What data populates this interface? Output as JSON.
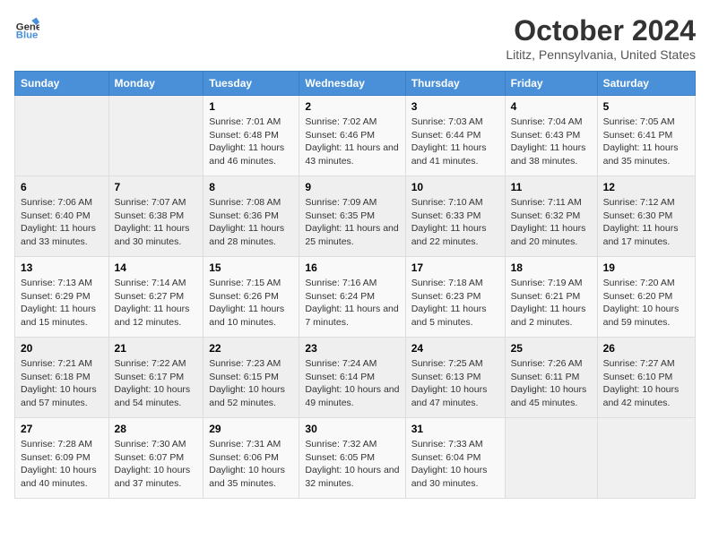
{
  "logo": {
    "general": "General",
    "blue": "Blue"
  },
  "title": "October 2024",
  "subtitle": "Lititz, Pennsylvania, United States",
  "days_of_week": [
    "Sunday",
    "Monday",
    "Tuesday",
    "Wednesday",
    "Thursday",
    "Friday",
    "Saturday"
  ],
  "weeks": [
    [
      {
        "day": "",
        "info": ""
      },
      {
        "day": "",
        "info": ""
      },
      {
        "day": "1",
        "info": "Sunrise: 7:01 AM\nSunset: 6:48 PM\nDaylight: 11 hours and 46 minutes."
      },
      {
        "day": "2",
        "info": "Sunrise: 7:02 AM\nSunset: 6:46 PM\nDaylight: 11 hours and 43 minutes."
      },
      {
        "day": "3",
        "info": "Sunrise: 7:03 AM\nSunset: 6:44 PM\nDaylight: 11 hours and 41 minutes."
      },
      {
        "day": "4",
        "info": "Sunrise: 7:04 AM\nSunset: 6:43 PM\nDaylight: 11 hours and 38 minutes."
      },
      {
        "day": "5",
        "info": "Sunrise: 7:05 AM\nSunset: 6:41 PM\nDaylight: 11 hours and 35 minutes."
      }
    ],
    [
      {
        "day": "6",
        "info": "Sunrise: 7:06 AM\nSunset: 6:40 PM\nDaylight: 11 hours and 33 minutes."
      },
      {
        "day": "7",
        "info": "Sunrise: 7:07 AM\nSunset: 6:38 PM\nDaylight: 11 hours and 30 minutes."
      },
      {
        "day": "8",
        "info": "Sunrise: 7:08 AM\nSunset: 6:36 PM\nDaylight: 11 hours and 28 minutes."
      },
      {
        "day": "9",
        "info": "Sunrise: 7:09 AM\nSunset: 6:35 PM\nDaylight: 11 hours and 25 minutes."
      },
      {
        "day": "10",
        "info": "Sunrise: 7:10 AM\nSunset: 6:33 PM\nDaylight: 11 hours and 22 minutes."
      },
      {
        "day": "11",
        "info": "Sunrise: 7:11 AM\nSunset: 6:32 PM\nDaylight: 11 hours and 20 minutes."
      },
      {
        "day": "12",
        "info": "Sunrise: 7:12 AM\nSunset: 6:30 PM\nDaylight: 11 hours and 17 minutes."
      }
    ],
    [
      {
        "day": "13",
        "info": "Sunrise: 7:13 AM\nSunset: 6:29 PM\nDaylight: 11 hours and 15 minutes."
      },
      {
        "day": "14",
        "info": "Sunrise: 7:14 AM\nSunset: 6:27 PM\nDaylight: 11 hours and 12 minutes."
      },
      {
        "day": "15",
        "info": "Sunrise: 7:15 AM\nSunset: 6:26 PM\nDaylight: 11 hours and 10 minutes."
      },
      {
        "day": "16",
        "info": "Sunrise: 7:16 AM\nSunset: 6:24 PM\nDaylight: 11 hours and 7 minutes."
      },
      {
        "day": "17",
        "info": "Sunrise: 7:18 AM\nSunset: 6:23 PM\nDaylight: 11 hours and 5 minutes."
      },
      {
        "day": "18",
        "info": "Sunrise: 7:19 AM\nSunset: 6:21 PM\nDaylight: 11 hours and 2 minutes."
      },
      {
        "day": "19",
        "info": "Sunrise: 7:20 AM\nSunset: 6:20 PM\nDaylight: 10 hours and 59 minutes."
      }
    ],
    [
      {
        "day": "20",
        "info": "Sunrise: 7:21 AM\nSunset: 6:18 PM\nDaylight: 10 hours and 57 minutes."
      },
      {
        "day": "21",
        "info": "Sunrise: 7:22 AM\nSunset: 6:17 PM\nDaylight: 10 hours and 54 minutes."
      },
      {
        "day": "22",
        "info": "Sunrise: 7:23 AM\nSunset: 6:15 PM\nDaylight: 10 hours and 52 minutes."
      },
      {
        "day": "23",
        "info": "Sunrise: 7:24 AM\nSunset: 6:14 PM\nDaylight: 10 hours and 49 minutes."
      },
      {
        "day": "24",
        "info": "Sunrise: 7:25 AM\nSunset: 6:13 PM\nDaylight: 10 hours and 47 minutes."
      },
      {
        "day": "25",
        "info": "Sunrise: 7:26 AM\nSunset: 6:11 PM\nDaylight: 10 hours and 45 minutes."
      },
      {
        "day": "26",
        "info": "Sunrise: 7:27 AM\nSunset: 6:10 PM\nDaylight: 10 hours and 42 minutes."
      }
    ],
    [
      {
        "day": "27",
        "info": "Sunrise: 7:28 AM\nSunset: 6:09 PM\nDaylight: 10 hours and 40 minutes."
      },
      {
        "day": "28",
        "info": "Sunrise: 7:30 AM\nSunset: 6:07 PM\nDaylight: 10 hours and 37 minutes."
      },
      {
        "day": "29",
        "info": "Sunrise: 7:31 AM\nSunset: 6:06 PM\nDaylight: 10 hours and 35 minutes."
      },
      {
        "day": "30",
        "info": "Sunrise: 7:32 AM\nSunset: 6:05 PM\nDaylight: 10 hours and 32 minutes."
      },
      {
        "day": "31",
        "info": "Sunrise: 7:33 AM\nSunset: 6:04 PM\nDaylight: 10 hours and 30 minutes."
      },
      {
        "day": "",
        "info": ""
      },
      {
        "day": "",
        "info": ""
      }
    ]
  ]
}
